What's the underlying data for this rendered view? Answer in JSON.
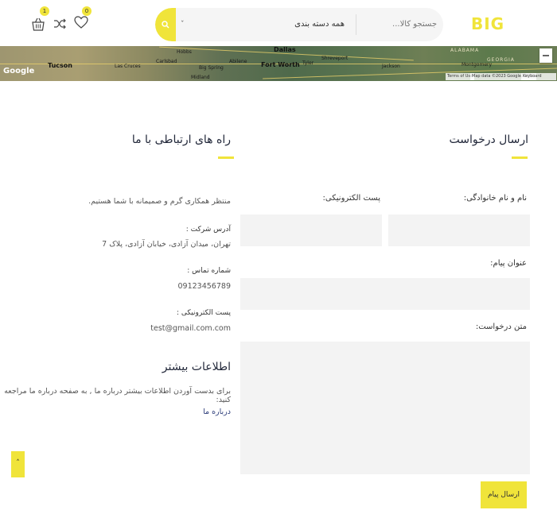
{
  "header": {
    "logo": "BIG",
    "search_placeholder": "جستجو کالا...",
    "category_label": "همه دسته بندی",
    "search_icon": "search-icon",
    "cart_count": "1",
    "wishlist_count": "0"
  },
  "map": {
    "google_label": "Google",
    "cities": [
      "Tucson",
      "Las Cruces",
      "Carlsbad",
      "Midland",
      "Big Spring",
      "Hobbs",
      "Abilene",
      "Fort Worth",
      "Dallas",
      "Tyler",
      "Shreveport",
      "Jackson",
      "Montgomery"
    ],
    "states": [
      "ALABAMA",
      "GEORGIA"
    ],
    "attribution": [
      "Terms of Use",
      "Map data ©2023 Google, INEGI",
      "Keyboard shortcuts"
    ]
  },
  "request_form": {
    "title": "ارسال درخواست",
    "name_label": "نام و نام خانوادگی:",
    "email_label": "پست الکترونیکی:",
    "subject_label": "عنوان پیام:",
    "message_label": "متن درخواست:",
    "submit_label": "ارسال پیام"
  },
  "contact": {
    "title": "راه های ارتباطی با ما",
    "intro": "منتظر همکاری گرم و صمیمانه با شما هستیم.",
    "address_label": "آدرس شرکت :",
    "address_value": "تهران، میدان آزادی، خیابان آزادی، پلاک 7",
    "phone_label": "شماره تماس :",
    "phone_value": "09123456789",
    "email_label": "پست الکترونیکی :",
    "email_value": "test@gmail.com.com",
    "more_title": "اطلاعات بیشتر",
    "more_text": "برای بدست آوردن اطلاعات بیشتر درباره ما , به صفحه درباره ما مراجعه کنید:",
    "more_link": "درباره ما"
  },
  "scroll_top_label": "˄",
  "colors": {
    "accent": "#f0e43a",
    "title": "#22283a",
    "field_bg": "#f3f3f3"
  }
}
